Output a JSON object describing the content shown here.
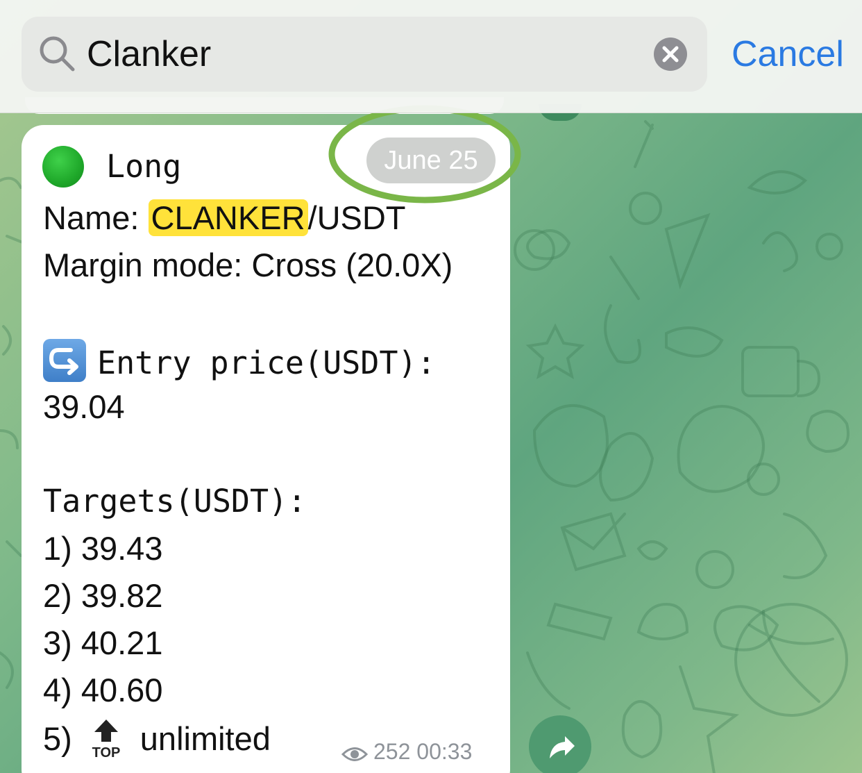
{
  "search": {
    "value": "Clanker",
    "cancel_label": "Cancel"
  },
  "message": {
    "date_badge": "June 25",
    "direction": "Long",
    "name_label": "Name: ",
    "name_highlight": "CLANKER",
    "name_rest": "/USDT",
    "margin_mode": "Margin mode: Cross (20.0X)",
    "entry_label": "Entry price(USDT):",
    "entry_value": "39.04",
    "targets_label": "Targets(USDT):",
    "targets": [
      "1) 39.43",
      "2) 39.82",
      "3) 40.21",
      "4) 40.60"
    ],
    "target5_prefix": "5)",
    "target5_value": "unlimited",
    "top_icon_text": "TOP",
    "views": "252",
    "time": "00:33"
  },
  "icons": {
    "search": "search-icon",
    "clear": "clear-icon",
    "direction": "green-circle-icon",
    "entry": "right-arrow-curving-left-icon",
    "top": "top-arrow-icon",
    "views": "eye-icon",
    "share": "share-icon"
  },
  "colors": {
    "accent": "#2a7ae2",
    "highlight": "#ffe23a",
    "annotation": "#7ab648",
    "wallpaper": "#6fae83"
  }
}
